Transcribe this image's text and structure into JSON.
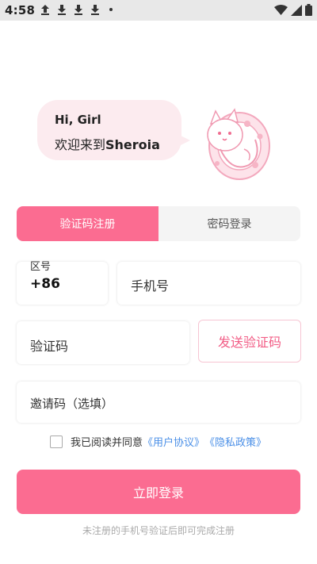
{
  "status_bar": {
    "time": "4:58",
    "icons": [
      "upload-icon",
      "download-icon",
      "download-icon",
      "download-icon",
      "dot-icon",
      "wifi-icon",
      "signal-icon",
      "battery-icon"
    ]
  },
  "greeting": {
    "line1": "Hi, Girl",
    "line2_prefix": "欢迎来到",
    "line2_brand": "Sheroia"
  },
  "tabs": [
    {
      "label": "验证码注册",
      "active": true
    },
    {
      "label": "密码登录",
      "active": false
    }
  ],
  "form": {
    "area_code_label": "区号",
    "area_code_value": "+86",
    "phone_placeholder": "手机号",
    "code_placeholder": "验证码",
    "send_code_label": "发送验证码",
    "invite_placeholder": "邀请码（选填）"
  },
  "agreement": {
    "prefix": "我已阅读并同意",
    "user_agreement": "《用户协议》",
    "privacy_policy": "《隐私政策》",
    "checked": false
  },
  "login_button": "立即登录",
  "hint": "未注册的手机号验证后即可完成注册",
  "colors": {
    "accent": "#fb6c91",
    "bubble": "#fcebef",
    "link": "#4a8fe7",
    "send_text": "#f25d86"
  }
}
